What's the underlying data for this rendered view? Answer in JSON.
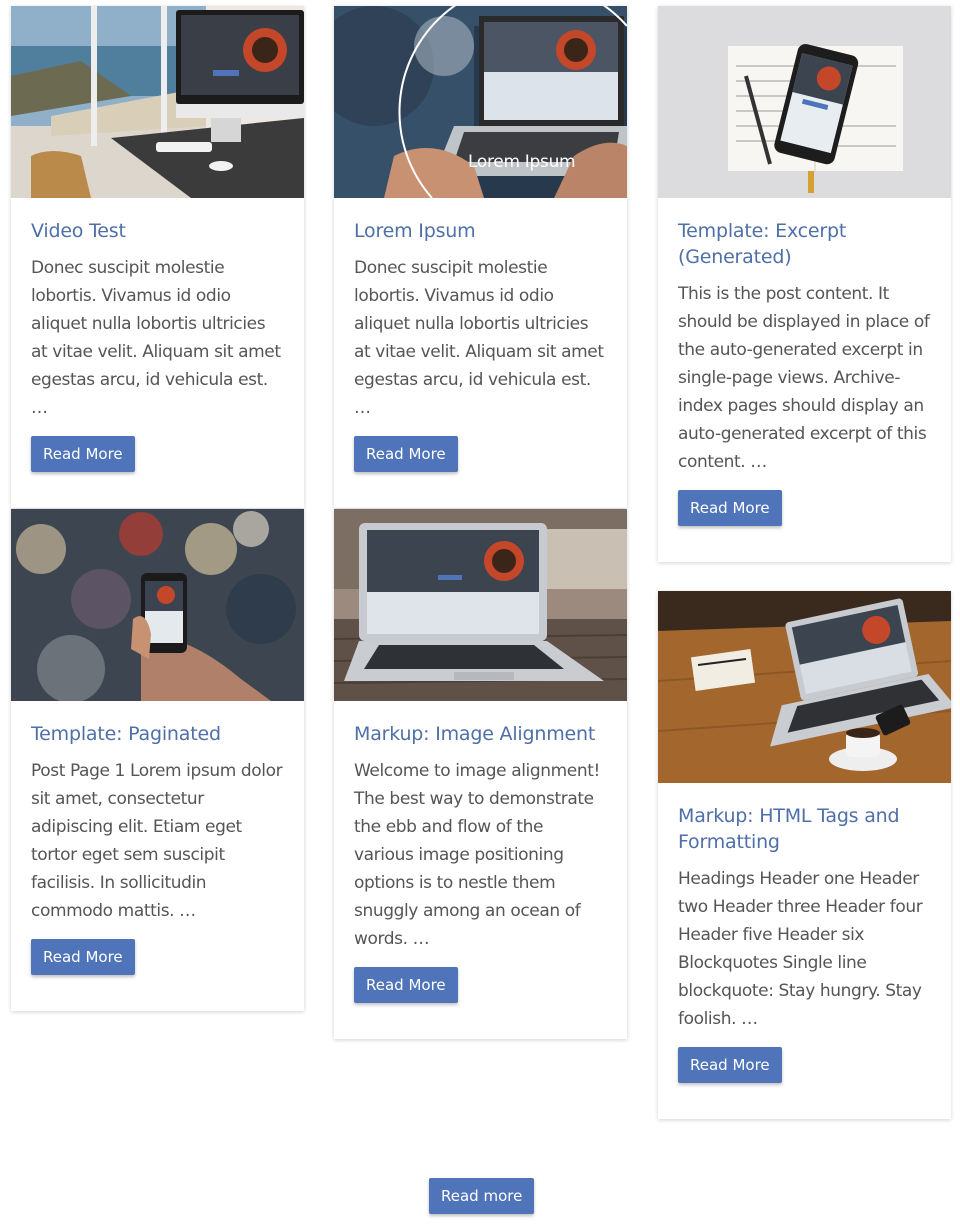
{
  "posts": [
    {
      "title": "Video Test",
      "excerpt": "Donec suscipit molestie lobortis. Vivamus id odio aliquet nulla lobortis ultricies at vitae velit. Aliquam sit amet egestas arcu, id vehicula est. …",
      "button": "Read More"
    },
    {
      "title": "Lorem Ipsum",
      "excerpt": "Donec suscipit molestie lobortis. Vivamus id odio aliquet nulla lobortis ultricies at vitae velit. Aliquam sit amet egestas arcu, id vehicula est. …",
      "button": "Read More",
      "image_caption": "Lorem Ipsum"
    },
    {
      "title": "Template: Excerpt (Generated)",
      "excerpt": "This is the post content. It should be displayed in place of the auto-generated excerpt in single-page views. Archive-index pages should display an auto-generated excerpt of this content. …",
      "button": "Read More"
    },
    {
      "title": "Template: Paginated",
      "excerpt": "Post Page 1 Lorem ipsum dolor sit amet, consectetur adipiscing elit. Etiam eget tortor eget sem suscipit facilisis. In sollicitudin commodo mattis. …",
      "button": "Read More"
    },
    {
      "title": "Markup: Image Alignment",
      "excerpt": "Welcome to image alignment! The best way to demonstrate the ebb and flow of the various image positioning options is to nestle them snuggly among an ocean of words. …",
      "button": "Read More"
    },
    {
      "title": "Markup: HTML Tags and Formatting",
      "excerpt": "Headings Header one Header two Header three Header four Header five Header six Blockquotes Single line blockquote: Stay hungry. Stay foolish. …",
      "button": "Read More"
    }
  ],
  "load_more": "Read more",
  "colors": {
    "accent": "#4f74b9",
    "title": "#4e6fa8",
    "text": "#555555"
  }
}
